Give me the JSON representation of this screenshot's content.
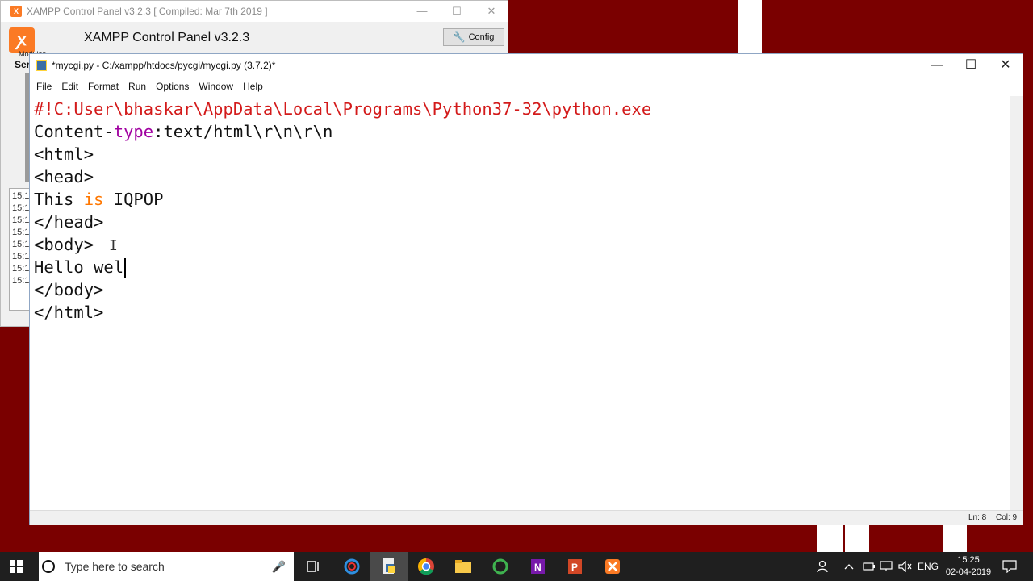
{
  "xampp": {
    "window_title": "XAMPP Control Panel v3.2.3   [ Compiled: Mar 7th 2019 ]",
    "heading": "XAMPP Control Panel v3.2.3",
    "config_button": "Config",
    "modules_label": "Modules",
    "service_label": "Ser",
    "log_times": [
      "15:1",
      "15:1",
      "15:1",
      "15:1",
      "15:1",
      "15:1",
      "15:1",
      "15:1"
    ],
    "logo_text": "ꭗ"
  },
  "idle": {
    "title": "*mycgi.py - C:/xampp/htdocs/pycgi/mycgi.py (3.7.2)*",
    "menu": [
      "File",
      "Edit",
      "Format",
      "Run",
      "Options",
      "Window",
      "Help"
    ],
    "code": {
      "line1": "#!C:User\\bhaskar\\AppData\\Local\\Programs\\Python37-32\\python.exe",
      "line2_a": "Content-",
      "line2_b": "type",
      "line2_c": ":text/html\\r\\n\\r\\n",
      "line3": "<html>",
      "line4": "<head>",
      "line5_a": "This ",
      "line5_b": "is",
      "line5_c": " IQPOP",
      "line6": "</head>",
      "line7": "<body>",
      "line8": "Hello wel",
      "line9": "</body>",
      "line10": "</html>"
    },
    "status": {
      "line": "Ln: 8",
      "col": "Col: 9"
    }
  },
  "taskbar": {
    "search_placeholder": "Type here to search",
    "language": "ENG",
    "time": "15:25",
    "date": "02-04-2019"
  },
  "colors": {
    "desktop": "#7a0000",
    "comment": "#d31a1a",
    "keyword": "#ff7700",
    "builtin": "#a000a0"
  }
}
